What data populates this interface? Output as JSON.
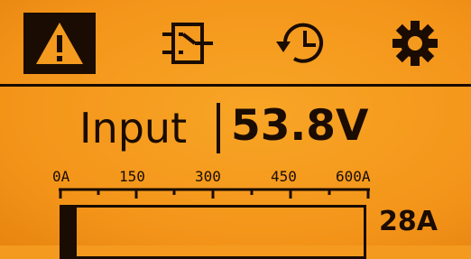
{
  "toolbar": {
    "buttons": [
      {
        "icon": "warning-icon",
        "active": true
      },
      {
        "icon": "transfer-switch-icon",
        "active": false
      },
      {
        "icon": "history-clock-icon",
        "active": false
      },
      {
        "icon": "gear-icon",
        "active": false
      }
    ]
  },
  "readout": {
    "label": "Input",
    "value": "53.8V"
  },
  "meter": {
    "scale_labels": [
      "0A",
      "150",
      "300",
      "450",
      "600A"
    ],
    "max_amps": 600,
    "current_amps": 28,
    "current_label": "28A"
  },
  "colors": {
    "background": "#f49a1e",
    "foreground": "#1a0c02"
  }
}
